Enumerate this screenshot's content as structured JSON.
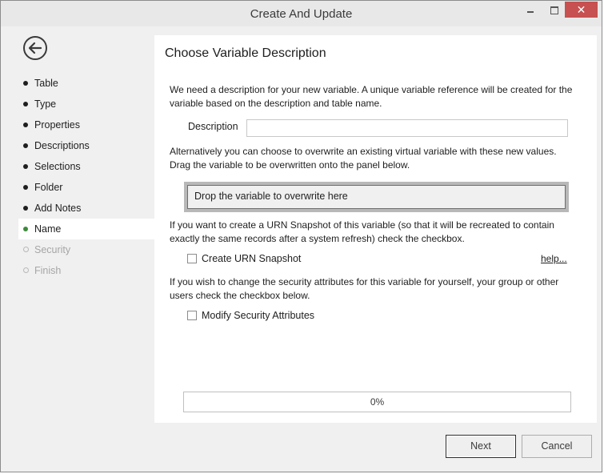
{
  "window": {
    "title": "Create And Update"
  },
  "sidebar": {
    "items": [
      {
        "label": "Table",
        "state": "complete"
      },
      {
        "label": "Type",
        "state": "complete"
      },
      {
        "label": "Properties",
        "state": "complete"
      },
      {
        "label": "Descriptions",
        "state": "complete"
      },
      {
        "label": "Selections",
        "state": "complete"
      },
      {
        "label": "Folder",
        "state": "complete"
      },
      {
        "label": "Add Notes",
        "state": "complete"
      },
      {
        "label": "Name",
        "state": "active"
      },
      {
        "label": "Security",
        "state": "disabled"
      },
      {
        "label": "Finish",
        "state": "disabled"
      }
    ]
  },
  "main": {
    "heading": "Choose Variable Description",
    "intro": "We need a description for your new variable.  A unique variable reference will be created for the variable based on the description and table name.",
    "description": {
      "label": "Description",
      "value": "",
      "placeholder": ""
    },
    "overwrite_text": "Alternatively you can choose to overwrite an existing virtual variable with these new values. Drag the variable to be overwritten onto the panel below.",
    "drop_zone": "Drop the variable to overwrite here",
    "urn_text": "If you want to create a URN Snapshot of this variable (so that it will be recreated to contain exactly the same records after a system refresh) check the checkbox.",
    "urn_checkbox": {
      "label": "Create URN Snapshot",
      "checked": false
    },
    "help_link": "help...",
    "security_text": "If you wish to change the security attributes for this variable for yourself, your group or other users check the checkbox below.",
    "security_checkbox": {
      "label": "Modify Security Attributes",
      "checked": false
    },
    "progress": {
      "text": "0%",
      "value": 0
    }
  },
  "footer": {
    "next_label": "Next",
    "cancel_label": "Cancel"
  },
  "colors": {
    "active_dot": "#3c8a3c",
    "close_button": "#c75050"
  }
}
